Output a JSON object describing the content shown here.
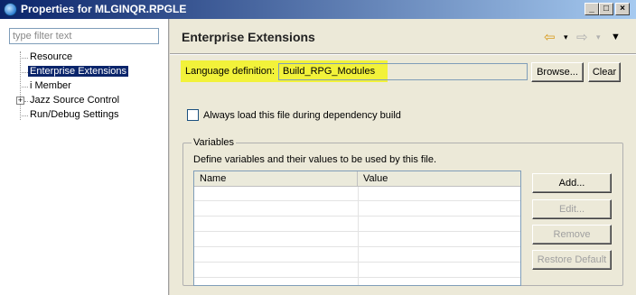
{
  "window": {
    "title": "Properties for MLGINQR.RPGLE",
    "minimize": "_",
    "maximize": "□",
    "close": "×"
  },
  "left": {
    "filter_placeholder": "type filter text",
    "tree": [
      {
        "label": "Resource"
      },
      {
        "label": "Enterprise Extensions",
        "selected": true
      },
      {
        "label": "i Member"
      },
      {
        "label": "Jazz Source Control",
        "expandable": true
      },
      {
        "label": "Run/Debug Settings"
      }
    ],
    "expander": "+"
  },
  "right": {
    "title": "Enterprise Extensions",
    "nav": {
      "back": "⇦",
      "back_menu": "▾",
      "forward": "⇨",
      "forward_menu": "▾",
      "view_menu": "▼"
    },
    "language_label": "Language definition:",
    "language_value": "Build_RPG_Modules",
    "browse_label": "Browse...",
    "clear_label": "Clear",
    "checkbox_label": "Always load this file during dependency build",
    "checkbox_checked": false,
    "variables": {
      "group_title": "Variables",
      "description": "Define variables and their values to be used by this file.",
      "columns": [
        "Name",
        "Value"
      ],
      "rows": [],
      "buttons": {
        "add": "Add...",
        "edit": "Edit...",
        "remove": "Remove",
        "restore": "Restore Default"
      }
    }
  },
  "colors": {
    "highlight": "#f2f23a",
    "selection": "#0a246a",
    "title_gradient_start": "#0a246a"
  }
}
